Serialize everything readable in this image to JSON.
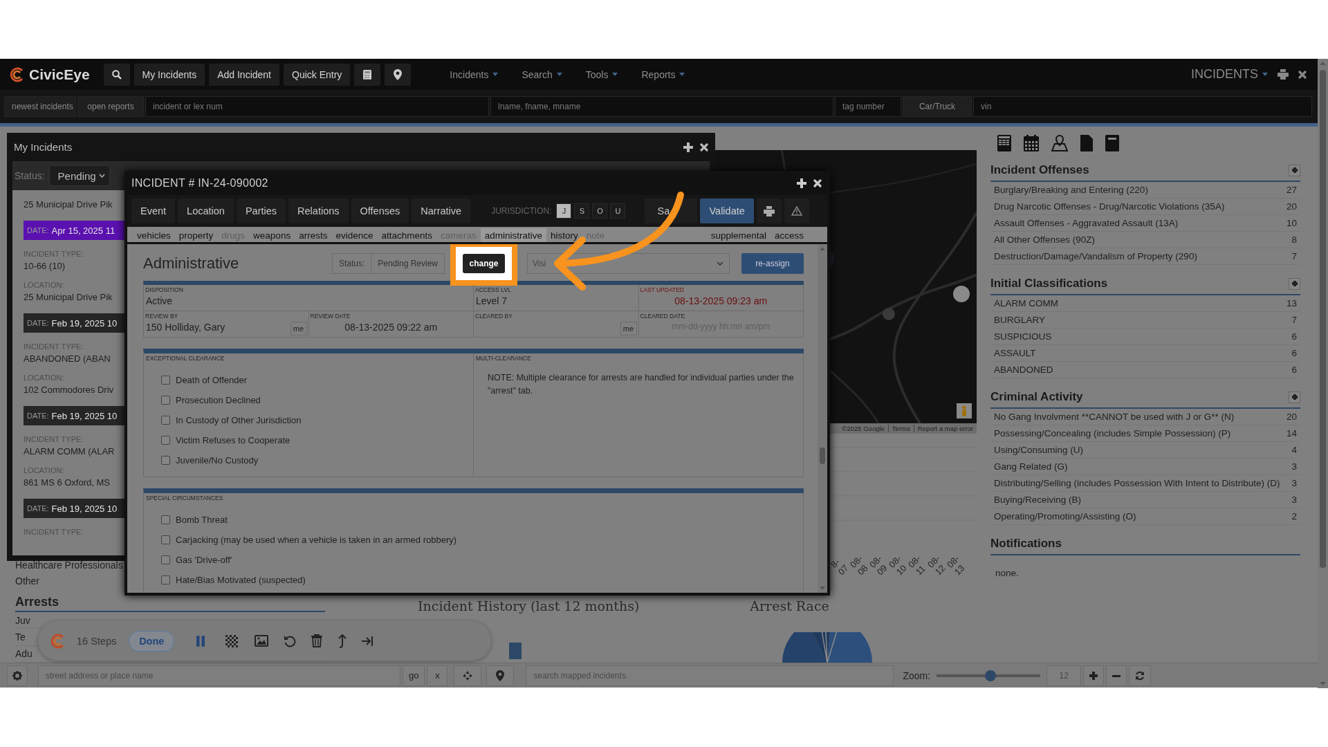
{
  "navbar": {
    "logo": "CivicEye",
    "buttons": [
      "My Incidents",
      "Add Incident",
      "Quick Entry"
    ],
    "menus": [
      "Incidents",
      "Search",
      "Tools",
      "Reports"
    ],
    "module": "INCIDENTS"
  },
  "quick_search": [
    {
      "kind": "button",
      "label": "newest incidents"
    },
    {
      "kind": "button",
      "label": "open reports"
    },
    {
      "kind": "field",
      "placeholder": "incident or lex num"
    },
    {
      "kind": "field",
      "placeholder": "lname, fname, mname"
    },
    {
      "kind": "field",
      "placeholder": "tag number"
    },
    {
      "kind": "button",
      "label": "Car/Truck"
    },
    {
      "kind": "field",
      "placeholder": "vin"
    }
  ],
  "my_incidents": {
    "title": "My Incidents",
    "status_label": "Status:",
    "status_value": "Pending",
    "items": [
      {
        "location": "25 Municipal Drive Pik"
      },
      {
        "date_label": "DATE:",
        "date": "Apr 15, 2025 11",
        "color": "#5b10b0",
        "type_label": "INCIDENT TYPE:",
        "type": "10-66 (10)",
        "location_label": "LOCATION:",
        "location": "25 Municipal Drive Pik"
      },
      {
        "date_label": "DATE:",
        "date": "Feb 19, 2025 10",
        "color": "#262626",
        "type_label": "INCIDENT TYPE:",
        "type": "ABANDONED (ABAN",
        "location_label": "LOCATION:",
        "location": "102 Commodores Driv"
      },
      {
        "date_label": "DATE:",
        "date": "Feb 19, 2025 10",
        "color": "#262626",
        "type_label": "INCIDENT TYPE:",
        "type": "ALARM COMM (ALAR",
        "location_label": "LOCATION:",
        "location": "861 MS 6 Oxford, MS"
      },
      {
        "date_label": "DATE:",
        "date": "Feb 19, 2025 10",
        "color": "#262626",
        "type_label": "INCIDENT TYPE:"
      }
    ]
  },
  "modal": {
    "title": "INCIDENT # IN-24-090002",
    "tabs": [
      "Event",
      "Location",
      "Parties",
      "Relations",
      "Offenses",
      "Narrative"
    ],
    "jurisdiction_label": "JURISDICTION:",
    "jurisdictions": [
      {
        "label": "J",
        "selected": true
      },
      {
        "label": "S",
        "selected": false
      },
      {
        "label": "O",
        "selected": false
      },
      {
        "label": "U",
        "selected": false
      }
    ],
    "save": "Sa",
    "validate": "Validate",
    "subtabs": [
      {
        "label": "vehicles",
        "selected": false,
        "disabled": false
      },
      {
        "label": "property",
        "selected": false,
        "disabled": false
      },
      {
        "label": "drugs",
        "selected": false,
        "disabled": true
      },
      {
        "label": "weapons",
        "selected": false,
        "disabled": false
      },
      {
        "label": "arrests",
        "selected": false,
        "disabled": false
      },
      {
        "label": "evidence",
        "selected": false,
        "disabled": false
      },
      {
        "label": "attachments",
        "selected": false,
        "disabled": false
      },
      {
        "label": "cameras",
        "selected": false,
        "disabled": true
      },
      {
        "label": "administrative",
        "selected": true,
        "disabled": false
      },
      {
        "label": "history",
        "selected": false,
        "disabled": false
      },
      {
        "label": "note",
        "selected": false,
        "disabled": true
      }
    ],
    "subtabs_right": [
      {
        "label": "supplemental",
        "selected": false,
        "disabled": false
      },
      {
        "label": "access",
        "selected": false,
        "disabled": false
      }
    ],
    "section_title": "Administrative",
    "status_label": "Status:",
    "status_value": "Pending Review",
    "change": "change",
    "visibility": "Visi",
    "reassign": "re-assign",
    "fields": [
      {
        "kind": "text",
        "label": "DISPOSITION",
        "value": "Active",
        "wide": true,
        "emphasis": false
      },
      {
        "kind": "text",
        "label": "ACCESS LVL",
        "value": "Level 7",
        "wide": false,
        "emphasis": false
      },
      {
        "kind": "date",
        "label": "LAST UPDATED",
        "value": "08-13-2025 09:23 am",
        "wide": false,
        "emphasis": true
      },
      {
        "kind": "person",
        "label": "REVIEW BY",
        "value": "150 Holliday, Gary",
        "button": "me",
        "wide": false,
        "emphasis": false
      },
      {
        "kind": "date",
        "label": "REVIEW DATE",
        "value": "08-13-2025 09:22 am",
        "wide": false,
        "emphasis": false
      },
      {
        "kind": "person",
        "label": "CLEARED BY",
        "button": "me",
        "wide": false,
        "emphasis": false
      },
      {
        "kind": "date",
        "label": "CLEARED DATE",
        "placeholder": "mm-dd-yyyy hh:mn am/pm",
        "wide": false,
        "emphasis": false
      }
    ],
    "exceptional_clearance": {
      "title": "EXCEPTIONAL CLEARANCE",
      "options": [
        {
          "label": "Death of Offender",
          "checked": false
        },
        {
          "label": "Prosecution Declined",
          "checked": false
        },
        {
          "label": "In Custody of Other Jurisdiction",
          "checked": false
        },
        {
          "label": "Victim Refuses to Cooperate",
          "checked": false
        },
        {
          "label": "Juvenile/No Custody",
          "checked": false
        }
      ]
    },
    "multi_clearance": {
      "title": "MULTI-CLEARANCE",
      "note": "NOTE: Multiple clearance for arrests are handled for individual parties under the \"arrest\" tab."
    },
    "special_circumstances": {
      "title": "SPECIAL CIRCUMSTANCES",
      "options": [
        {
          "label": "Bomb Threat",
          "checked": false
        },
        {
          "label": "Carjacking (may be used when a vehicle is taken in an armed robbery)",
          "checked": false
        },
        {
          "label": "Gas 'Drive-off'",
          "checked": false
        },
        {
          "label": "Hate/Bias Motivated (suspected)",
          "checked": false
        }
      ]
    }
  },
  "dashboard": {
    "demographics": [
      "Healthcare Professionals",
      "Other"
    ],
    "arrests": {
      "title": "Arrests",
      "rows": [
        "Juv",
        "Te",
        "Adu"
      ]
    },
    "map": {
      "attribution": [
        "©2025 Google",
        "Terms",
        "Report a map error"
      ]
    },
    "incident_history": {
      "title": "Incident History (last 12 months)",
      "x_labels": [
        "8-07",
        "08-08",
        "08-09",
        "08-10",
        "08-11",
        "08-12",
        "08-13"
      ]
    },
    "arrest_race": {
      "title": "Arrest Race"
    }
  },
  "right_panel": [
    {
      "kind": "table",
      "title": "Incident Offenses",
      "rows": [
        {
          "label": "Burglary/Breaking and Entering (220)",
          "count": "27"
        },
        {
          "label": "Drug Narcotic Offenses - Drug/Narcotic Violations (35A)",
          "count": "20"
        },
        {
          "label": "Assault Offenses - Aggravated Assault (13A)",
          "count": "10"
        },
        {
          "label": "All Other Offenses (90Z)",
          "count": "8"
        },
        {
          "label": "Destruction/Damage/Vandalism of Property (290)",
          "count": "7"
        }
      ]
    },
    {
      "kind": "table",
      "title": "Initial Classifications",
      "rows": [
        {
          "label": "ALARM COMM",
          "count": "13"
        },
        {
          "label": "BURGLARY",
          "count": "7"
        },
        {
          "label": "SUSPICIOUS",
          "count": "6"
        },
        {
          "label": "ASSAULT",
          "count": "6"
        },
        {
          "label": "ABANDONED",
          "count": "6"
        }
      ]
    },
    {
      "kind": "table",
      "title": "Criminal Activity",
      "rows": [
        {
          "label": "No Gang Involvment **CANNOT be used with J or G** (N)",
          "count": "20"
        },
        {
          "label": "Possessing/Concealing (includes Simple Possession) (P)",
          "count": "14"
        },
        {
          "label": "Using/Consuming (U)",
          "count": "4"
        },
        {
          "label": "Gang Related (G)",
          "count": "3"
        },
        {
          "label": "Distributing/Selling (includes Possession With Intent to Distribute) (D)",
          "count": "3"
        },
        {
          "label": "Buying/Receiving (B)",
          "count": "3"
        },
        {
          "label": "Operating/Promoting/Assisting (O)",
          "count": "2"
        }
      ]
    },
    {
      "kind": "message",
      "title": "Notifications",
      "text": "none."
    }
  ],
  "map_bar": {
    "address_placeholder": "street address or place name",
    "go": "go",
    "clear": "x",
    "search_placeholder": "search mapped incidents",
    "zoom_label": "Zoom:",
    "zoom": {
      "level": 0.52
    },
    "zoom_value": "12"
  },
  "steps_toolbar": {
    "count": "16 Steps",
    "done": "Done"
  }
}
